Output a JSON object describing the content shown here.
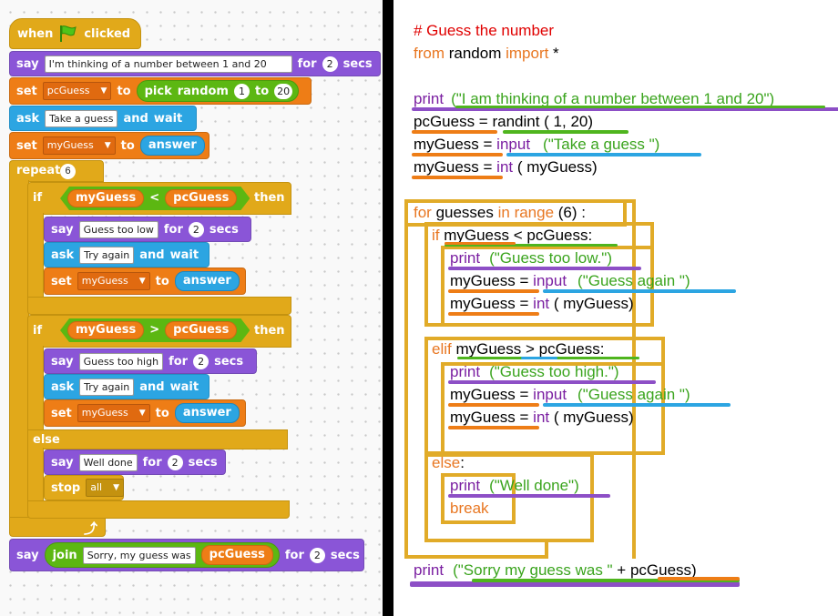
{
  "scratch": {
    "hat": {
      "when": "when",
      "clicked": "clicked"
    },
    "say1": {
      "say": "say",
      "text": "I'm thinking of a number between 1 and 20",
      "for": "for",
      "secs_value": "2",
      "secs": "secs"
    },
    "set_pc": {
      "set": "set",
      "var": "pcGuess",
      "to": "to",
      "pick": "pick",
      "random": "random",
      "from": "1",
      "to2": "to",
      "max": "20"
    },
    "ask1": {
      "ask": "ask",
      "text": "Take a guess",
      "and": "and",
      "wait": "wait"
    },
    "set_my": {
      "set": "set",
      "var": "myGuess",
      "to": "to",
      "answer": "answer"
    },
    "repeat": {
      "label": "repeat",
      "count": "6"
    },
    "if1": {
      "if": "if",
      "left": "myGuess",
      "op": "<",
      "right": "pcGuess",
      "then": "then"
    },
    "say_low": {
      "say": "say",
      "text": "Guess too low",
      "for": "for",
      "secs_value": "2",
      "secs": "secs"
    },
    "ask_again1": {
      "ask": "ask",
      "text": "Try again",
      "and": "and",
      "wait": "wait"
    },
    "set_my2": {
      "set": "set",
      "var": "myGuess",
      "to": "to",
      "answer": "answer"
    },
    "if2": {
      "if": "if",
      "left": "myGuess",
      "op": ">",
      "right": "pcGuess",
      "then": "then"
    },
    "say_high": {
      "say": "say",
      "text": "Guess too high",
      "for": "for",
      "secs_value": "2",
      "secs": "secs"
    },
    "ask_again2": {
      "ask": "ask",
      "text": "Try again",
      "and": "and",
      "wait": "wait"
    },
    "set_my3": {
      "set": "set",
      "var": "myGuess",
      "to": "to",
      "answer": "answer"
    },
    "else": "else",
    "say_done": {
      "say": "say",
      "text": "Well done",
      "for": "for",
      "secs_value": "2",
      "secs": "secs"
    },
    "stop": {
      "stop": "stop",
      "option": "all"
    },
    "say_final": {
      "say": "say",
      "join": "join",
      "text": "Sorry, my guess was",
      "var": "pcGuess",
      "for": "for",
      "secs_value": "2",
      "secs": "secs"
    }
  },
  "code": {
    "l1": "# Guess the number",
    "l2_from": "from",
    "l2_random": " random ",
    "l2_import": "import",
    "l2_star": " *",
    "l3_print": "print",
    "l3_str": "(\"I am thinking of a number between 1 and 20\")",
    "l4_a": "pcGuess = ",
    "l4_b": "randint",
    "l4_c": " ( 1, 20)",
    "l5_a": "myGuess = ",
    "l5_b": "input",
    "l5_c": "(\"Take a guess \")",
    "l6_a": "myGuess = ",
    "l6_b": "int",
    "l6_c": " ( myGuess)",
    "l7_for": "for",
    "l7_a": " guesses ",
    "l7_in": "in",
    "l7_range": " range",
    "l7_b": "  (6)  :",
    "l8_if": "if",
    "l8_a": " myGuess < pcGuess:",
    "l9_print": "print",
    "l9_str": "(\"Guess too low.\")",
    "l10_a": "myGuess = ",
    "l10_b": "input",
    "l10_c": "(\"Guess again \")",
    "l11_a": "myGuess = ",
    "l11_b": "int",
    "l11_c": " ( myGuess)",
    "l12_elif": "elif",
    "l12_a": " myGuess > pcGuess:",
    "l13_print": "print",
    "l13_str": "(\"Guess too high.\")",
    "l14_a": "myGuess = ",
    "l14_b": "input",
    "l14_c": "(\"Guess again \")",
    "l15_a": "myGuess = ",
    "l15_b": "int",
    "l15_c": " ( myGuess)",
    "l16_else": "else",
    "l16_colon": ":",
    "l17_print": "print",
    "l17_str": "(\"Well done\")",
    "l18_break": "break",
    "l19_print": "print",
    "l19_str": "(\"Sorry my guess was \"",
    "l19_rest": " + pcGuess)"
  },
  "colors": {
    "looks": "#8a55d7",
    "data": "#ee7d16",
    "sensing": "#2ca5e2",
    "control": "#e1a91a",
    "operators": "#5cb712",
    "comment": "#e00000"
  }
}
